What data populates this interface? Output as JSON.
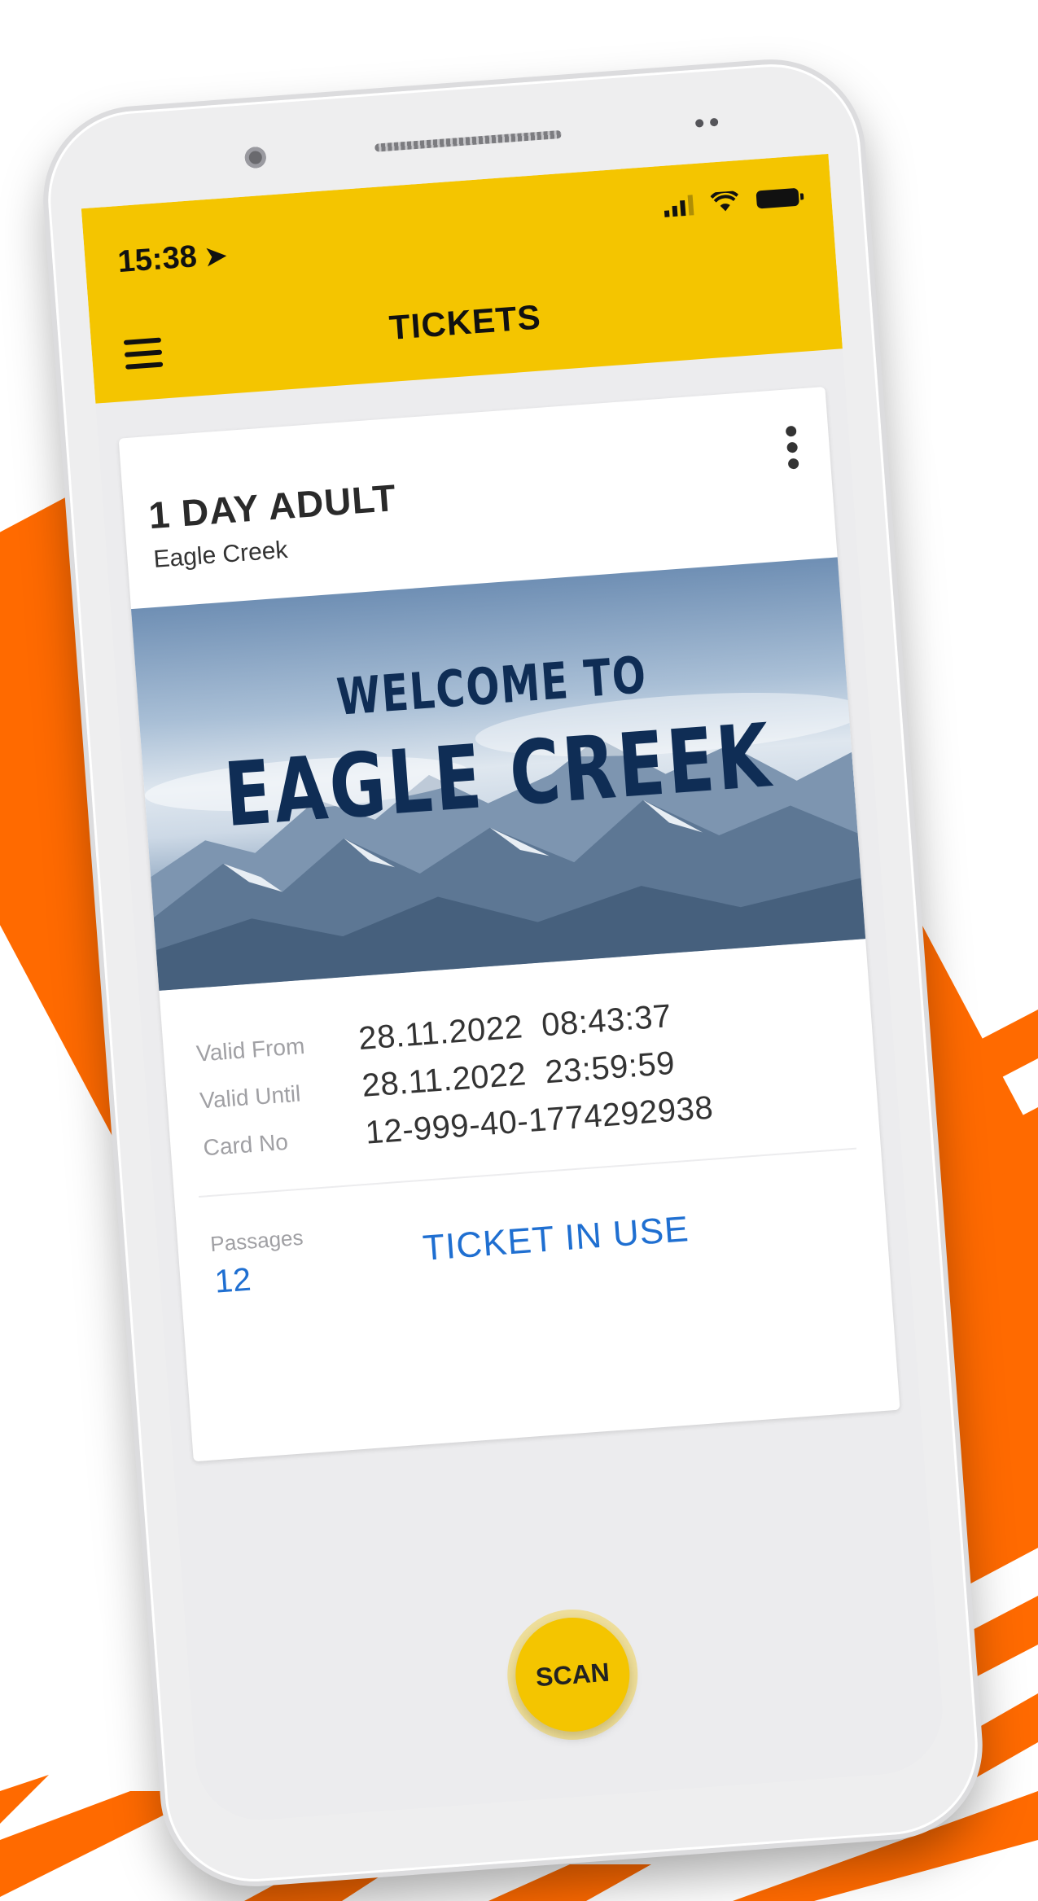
{
  "status_bar": {
    "time": "15:38"
  },
  "header": {
    "title": "TICKETS"
  },
  "ticket": {
    "title": "1 DAY ADULT",
    "location": "Eagle Creek",
    "banner": {
      "line1": "WELCOME TO",
      "line2": "EAGLE CREEK"
    },
    "details": [
      {
        "label": "Valid From",
        "value": "28.11.2022  08:43:37"
      },
      {
        "label": "Valid Until",
        "value": "28.11.2022  23:59:59"
      },
      {
        "label": "Card No",
        "value": "12-999-40-1774292938"
      }
    ],
    "passages_label": "Passages",
    "passages_value": "12",
    "status": "TICKET IN USE"
  },
  "scan_button": {
    "label": "SCAN"
  },
  "colors": {
    "accent": "#f4c500",
    "background_orange": "#ff6a00",
    "link_blue": "#1f6fd1"
  },
  "icons": [
    "location-arrow-icon",
    "signal-icon",
    "wifi-icon",
    "battery-icon",
    "menu-icon",
    "more-vert-icon"
  ]
}
